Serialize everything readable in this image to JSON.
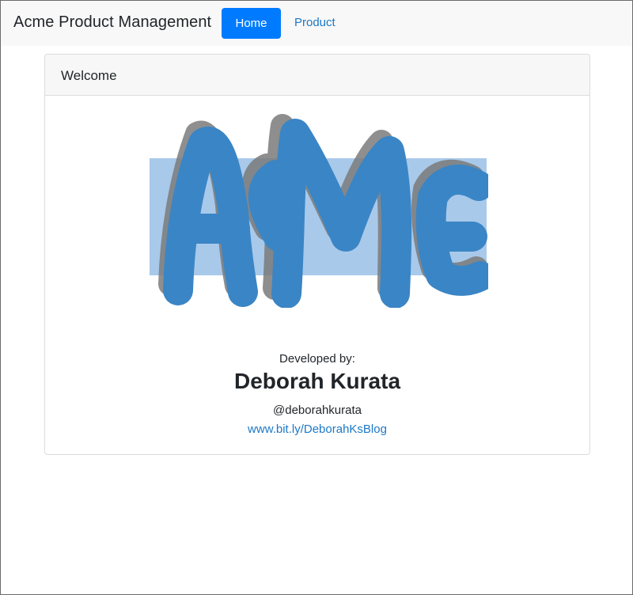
{
  "navbar": {
    "brand": "Acme Product Management",
    "home_label": "Home",
    "product_label": "Product",
    "active_color": "#007bff",
    "link_color": "#1c78c6"
  },
  "card": {
    "header_title": "Welcome",
    "logo_text": "AcMe",
    "logo_color": "#3a85c5",
    "developed_by_label": "Developed by:",
    "developer_name": "Deborah Kurata",
    "developer_handle": "@deborahkurata",
    "developer_blog": "www.bit.ly/DeborahKsBlog"
  }
}
